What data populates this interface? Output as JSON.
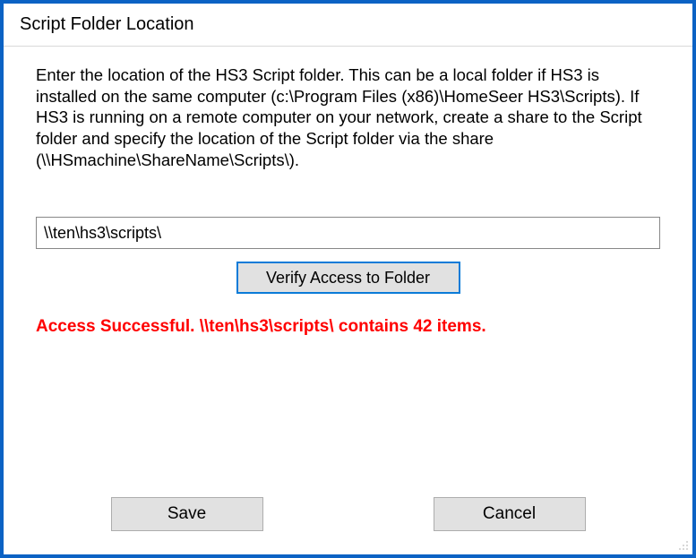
{
  "dialog": {
    "title": "Script Folder Location",
    "instructions": "Enter the location of the HS3 Script folder.  This can be a local folder if HS3 is installed on the same computer  (c:\\Program Files (x86)\\HomeSeer HS3\\Scripts). If HS3 is running on a remote computer on your network, create a share to the Script folder and specify the location of the Script folder via the share (\\\\HSmachine\\ShareName\\Scripts\\).",
    "path_value": "\\\\ten\\hs3\\scripts\\",
    "verify_label": "Verify Access to Folder",
    "status_message": "Access Successful. \\\\ten\\hs3\\scripts\\ contains 42 items.",
    "save_label": "Save",
    "cancel_label": "Cancel"
  },
  "colors": {
    "window_border": "#0b62c4",
    "status_text": "#ff0000",
    "button_bg": "#e1e1e1",
    "focus_border": "#0a7bd8"
  }
}
